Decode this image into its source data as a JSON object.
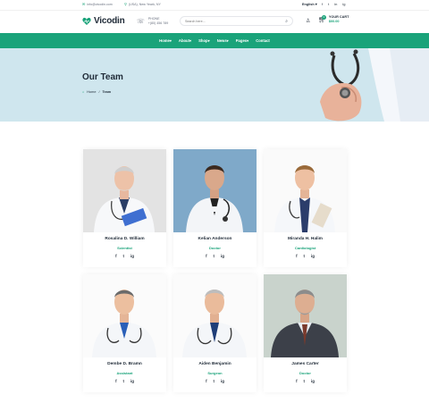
{
  "topbar": {
    "email": "info@vicodin.com",
    "address": "(USA), New Yeark, NY",
    "language": "English",
    "socials": [
      "f",
      "t",
      "in",
      "ig"
    ]
  },
  "header": {
    "logo": "Vicodin",
    "phone_label": "PHONE",
    "phone_number": "+(80) 456 789",
    "search_placeholder": "Search here...",
    "cart_title": "YOUR CART",
    "cart_amount": "$00.00",
    "cart_count": "0"
  },
  "nav": [
    "Home",
    "About",
    "Shop",
    "News",
    "Pages",
    "Contact"
  ],
  "nav_dropdown_marker": "▾",
  "hero": {
    "title": "Our Team",
    "breadcrumb_home": "Home",
    "breadcrumb_sep": "/",
    "breadcrumb_current": "Team"
  },
  "team": [
    {
      "name": "Rosalina D. William",
      "role": "Scientist"
    },
    {
      "name": "Kelian Anderson",
      "role": "Doctor"
    },
    {
      "name": "Miranda H. Halim",
      "role": "Cardiologist"
    },
    {
      "name": "Dembe D. Bramn",
      "role": "Assistant"
    },
    {
      "name": "Aiden Benjamin",
      "role": "Surgeon"
    },
    {
      "name": "James Carter",
      "role": "Doctor"
    }
  ],
  "card_socials": [
    "f",
    "t",
    "ig"
  ],
  "colors": {
    "accent": "#1aa37a",
    "hero_bg": "#cfe6ee",
    "text": "#1f2a37"
  }
}
